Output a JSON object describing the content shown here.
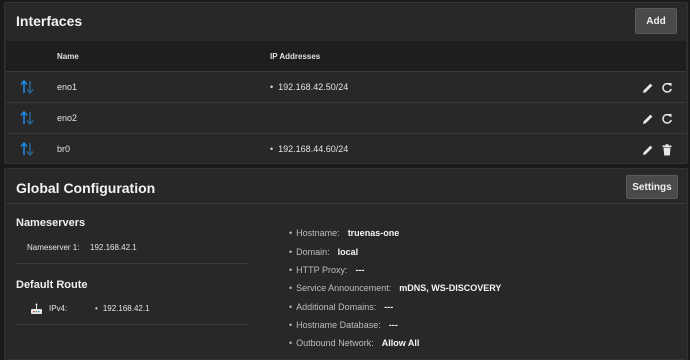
{
  "interfaces": {
    "title": "Interfaces",
    "add_label": "Add",
    "columns": {
      "name": "Name",
      "ip": "IP Addresses"
    },
    "rows": [
      {
        "name": "eno1",
        "ip": "192.168.42.50/24",
        "actions": [
          "edit-icon",
          "reset-icon"
        ]
      },
      {
        "name": "eno2",
        "ip": "",
        "actions": [
          "edit-icon",
          "reset-icon"
        ]
      },
      {
        "name": "br0",
        "ip": "192.168.44.60/24",
        "actions": [
          "edit-icon",
          "delete-icon"
        ]
      }
    ]
  },
  "global": {
    "title": "Global Configuration",
    "settings_label": "Settings",
    "nameservers": {
      "title": "Nameservers",
      "label": "Nameserver 1:",
      "value": "192.168.42.1"
    },
    "default_route": {
      "title": "Default Route",
      "label": "IPv4:",
      "value": "192.168.42.1"
    },
    "items": [
      {
        "label": "Hostname:",
        "value": "truenas-one"
      },
      {
        "label": "Domain:",
        "value": "local"
      },
      {
        "label": "HTTP Proxy:",
        "value": "---"
      },
      {
        "label": "Service Announcement:",
        "value": "mDNS, WS-DISCOVERY"
      },
      {
        "label": "Additional Domains:",
        "value": "---"
      },
      {
        "label": "Hostname Database:",
        "value": "---"
      },
      {
        "label": "Outbound Network:",
        "value": "Allow All"
      }
    ]
  },
  "colors": {
    "accent": "#1e88e5",
    "card": "#282828",
    "header": "#1e1e1e"
  }
}
